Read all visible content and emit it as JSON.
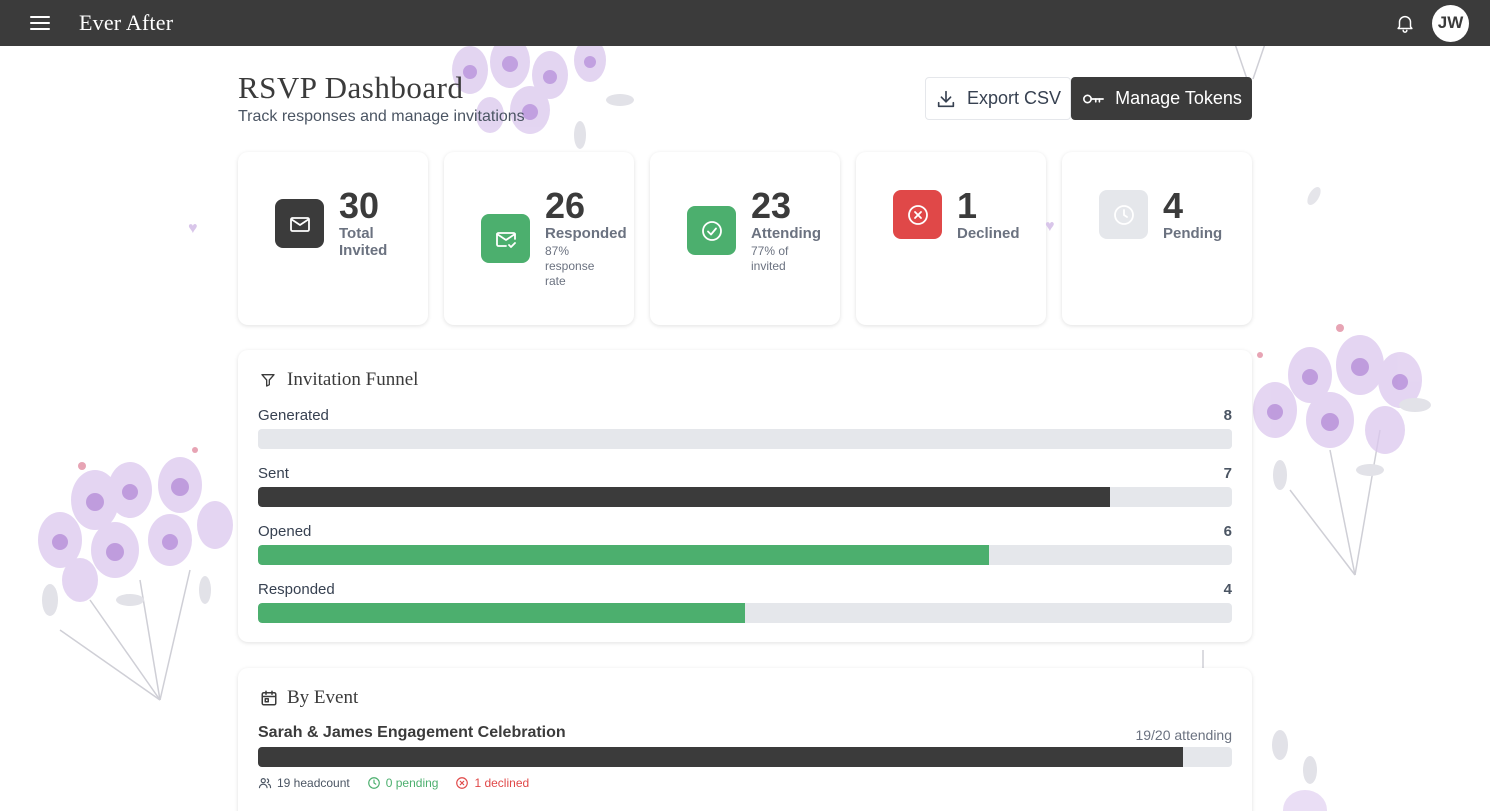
{
  "app": {
    "brand": "Ever After",
    "avatar_initials": "JW"
  },
  "header": {
    "title": "RSVP Dashboard",
    "subtitle": "Track responses and manage invitations"
  },
  "actions": {
    "export_label": "Export CSV",
    "tokens_label": "Manage Tokens"
  },
  "stats": [
    {
      "value": "30",
      "label": "Total Invited",
      "sub": "",
      "icon": "mail-icon",
      "color": "#3b3b3b"
    },
    {
      "value": "26",
      "label": "Responded",
      "sub": "87% response rate",
      "icon": "mail-check-icon",
      "color": "#4caf6e"
    },
    {
      "value": "23",
      "label": "Attending",
      "sub": "77% of invited",
      "icon": "check-circle-icon",
      "color": "#4caf6e"
    },
    {
      "value": "1",
      "label": "Declined",
      "sub": "",
      "icon": "x-circle-icon",
      "color": "#e04848"
    },
    {
      "value": "4",
      "label": "Pending",
      "sub": "",
      "icon": "clock-icon",
      "color": "#e5e7eb"
    }
  ],
  "funnel": {
    "title": "Invitation Funnel",
    "max": 8,
    "rows": [
      {
        "label": "Generated",
        "count": 8,
        "color": "#e5e7eb"
      },
      {
        "label": "Sent",
        "count": 7,
        "color": "#3b3b3b"
      },
      {
        "label": "Opened",
        "count": 6,
        "color": "#4caf6e"
      },
      {
        "label": "Responded",
        "count": 4,
        "color": "#4caf6e"
      }
    ]
  },
  "by_event": {
    "title": "By Event",
    "events": [
      {
        "name": "Sarah & James Engagement Celebration",
        "ratio": "19/20 attending",
        "attending": 19,
        "total": 20,
        "headcount": "19 headcount",
        "pending": "0 pending",
        "declined": "1 declined"
      }
    ]
  }
}
